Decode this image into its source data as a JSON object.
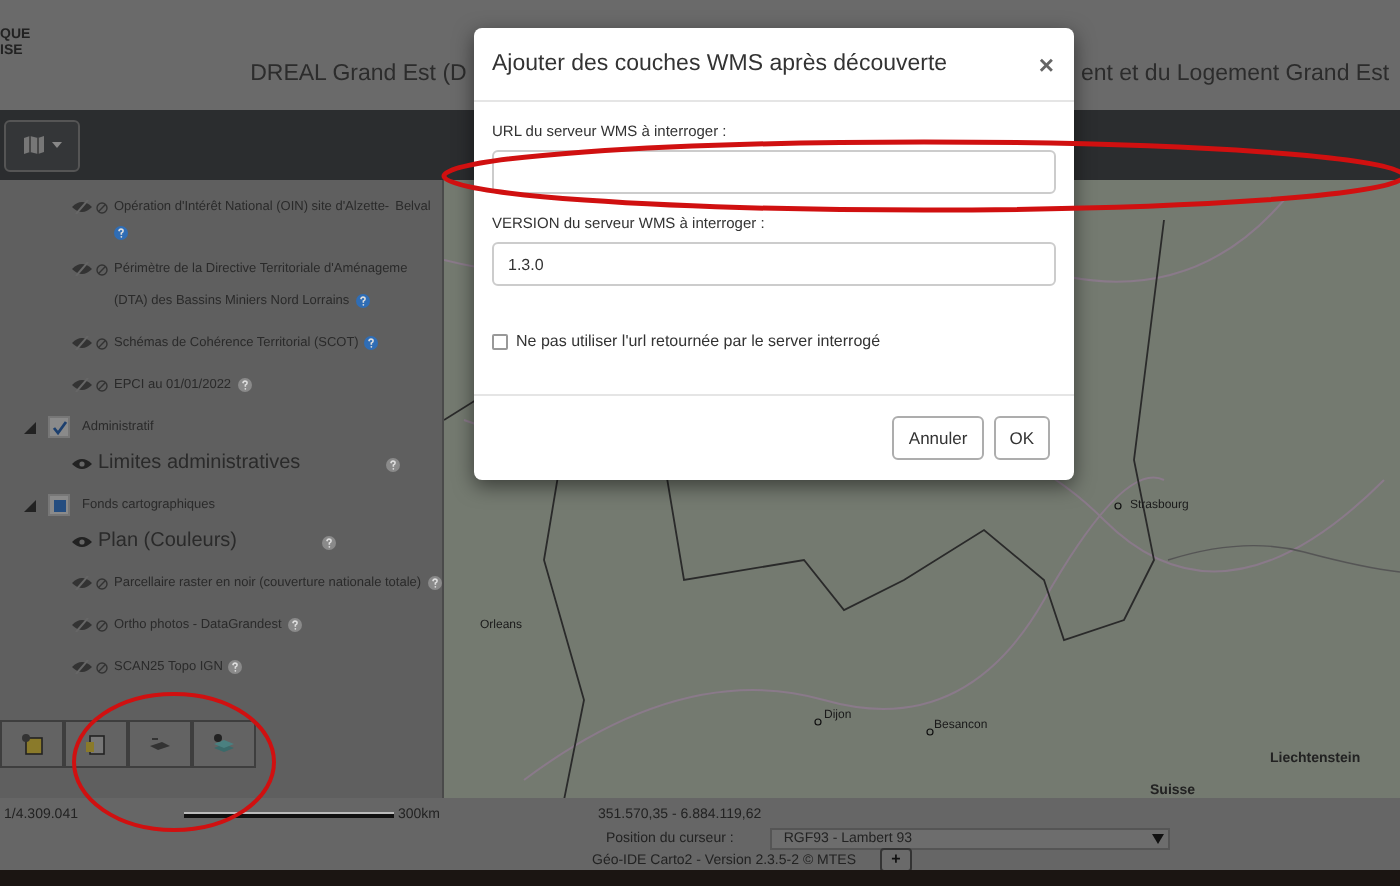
{
  "header": {
    "logo_lines": [
      "QUE",
      "ISE"
    ],
    "title_left": "DREAL Grand Est (D",
    "title_right": "ent et du Logement Grand Est"
  },
  "layer_panel": {
    "top_layers": [
      {
        "lines": [
          "Opération d'Intérêt National (OIN) site d'Alzette-",
          "Belval"
        ],
        "visible": false,
        "kind": "sub",
        "help_active": true
      },
      {
        "lines": [
          "Périmètre de la Directive Territoriale d'Aménageme",
          "(DTA) des Bassins Miniers Nord Lorrains"
        ],
        "visible": false,
        "kind": "sub",
        "help_active": true
      },
      {
        "lines": [
          "Schémas de Cohérence Territorial (SCOT)"
        ],
        "visible": false,
        "kind": "sub",
        "help_active": true
      },
      {
        "lines": [
          "EPCI au 01/01/2022"
        ],
        "visible": false,
        "kind": "sub",
        "help_active": false
      }
    ],
    "groups": [
      {
        "label": "Administratif",
        "checked": true,
        "expanded": true,
        "children": [
          {
            "lines": [
              "Limites administratives"
            ],
            "visible": true,
            "kind": "main",
            "help_active": false
          }
        ]
      },
      {
        "label": "Fonds cartographiques",
        "partial": true,
        "expanded": true,
        "children": [
          {
            "lines": [
              "Plan (Couleurs)"
            ],
            "visible": true,
            "kind": "main",
            "help_active": false
          },
          {
            "lines": [
              "Parcellaire raster en noir (couverture nationale totale)"
            ],
            "visible": false,
            "kind": "sub",
            "help_active": false
          },
          {
            "lines": [
              "Ortho photos - DataGrandest"
            ],
            "visible": false,
            "kind": "sub",
            "help_active": false
          },
          {
            "lines": [
              "SCAN25 Topo IGN"
            ],
            "visible": false,
            "kind": "sub",
            "help_active": false
          }
        ]
      }
    ],
    "tool_buttons": [
      {
        "kind": "add-layer"
      },
      {
        "kind": "add-file"
      },
      {
        "kind": "wms"
      },
      {
        "kind": "wms-discover"
      }
    ]
  },
  "map": {
    "places": [
      {
        "label": "Orleans",
        "kind": "city"
      },
      {
        "label": "Strasbourg",
        "kind": "city"
      },
      {
        "label": "Dijon",
        "kind": "city"
      },
      {
        "label": "Besancon",
        "kind": "city"
      },
      {
        "label": "Liechtenstein",
        "kind": "country"
      },
      {
        "label": "Suisse",
        "kind": "country"
      }
    ]
  },
  "scale": {
    "ratio": "1/4.309.041",
    "bar_label": "300km"
  },
  "cursor": {
    "label": "Position du curseur :",
    "coordinates": "351.570,35 - 6.884.119,62",
    "projection": "RGF93 - Lambert 93"
  },
  "footer": {
    "version": "Géo-IDE Carto2 - Version 2.3.5-2 © MTES",
    "button": "+"
  },
  "dialog": {
    "title": "Ajouter des couches WMS après découverte",
    "close": "×",
    "url_label": "URL du serveur WMS à interroger :",
    "version_label": "VERSION du serveur WMS à interroger :",
    "version_value": "1.3.0",
    "checkbox_label": "Ne pas utiliser l'url retournée par le server interrogé",
    "checkbox_checked": false,
    "buttons": [
      "Annuler",
      "OK"
    ]
  }
}
